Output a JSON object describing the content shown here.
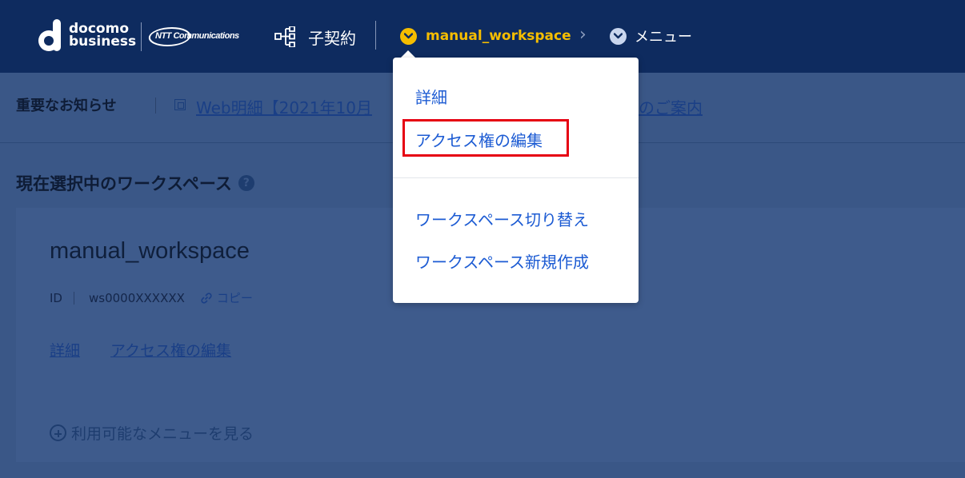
{
  "header": {
    "brand_top": "docomo",
    "brand_bottom": "business",
    "partner_logo": "NTT Communications",
    "child_contract_label": "子契約",
    "workspace_label": "manual_workspace",
    "menu_label": "メニュー",
    "colors": {
      "header_bg": "#0e2b5f",
      "workspace_accent": "#f5bd00",
      "chevron_circle": "#c9d6ee"
    }
  },
  "notice": {
    "label": "重要なお知らせ",
    "link_text": "Web明細【2021年10月",
    "link_tail": "のご案内"
  },
  "current_workspace": {
    "section_title": "現在選択中のワークスペース",
    "help_glyph": "?",
    "name": "manual_workspace",
    "id_label": "ID",
    "id_value": "ws0000XXXXXX",
    "copy_label": "コピー",
    "details_link": "詳細",
    "access_edit_link": "アクセス権の編集",
    "more_menu_label": "利用可能なメニューを見る"
  },
  "dropdown": {
    "items": [
      {
        "label": "詳細"
      },
      {
        "label": "アクセス権の編集",
        "highlighted": true
      },
      {
        "label": "ワークスペース切り替え"
      },
      {
        "label": "ワークスペース新規作成"
      }
    ],
    "link_color": "#1c5bd3",
    "highlight_color": "#e60012"
  }
}
